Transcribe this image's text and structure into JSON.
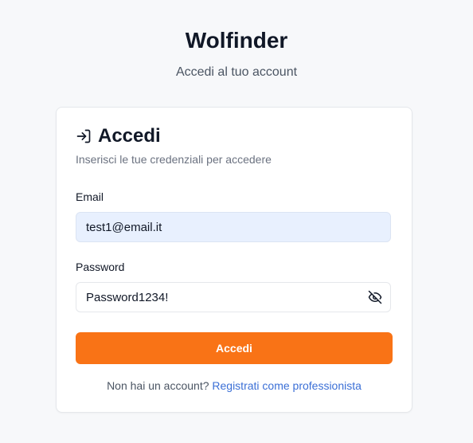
{
  "header": {
    "title": "Wolfinder",
    "subtitle": "Accedi al tuo account"
  },
  "card": {
    "title": "Accedi",
    "title_icon": "log-in-icon",
    "description": "Inserisci le tue credenziali per accedere",
    "email": {
      "label": "Email",
      "value": "test1@email.it"
    },
    "password": {
      "label": "Password",
      "value": "Password1234!",
      "toggle_icon": "eye-off-icon"
    },
    "submit_label": "Accedi",
    "footer": {
      "prompt": "Non hai un account?",
      "link_label": "Registrati come professionista"
    }
  },
  "colors": {
    "accent": "#f97316",
    "link": "#3b6fd6",
    "autofill_bg": "#e8f0fe",
    "page_bg": "#f7f8fa"
  }
}
